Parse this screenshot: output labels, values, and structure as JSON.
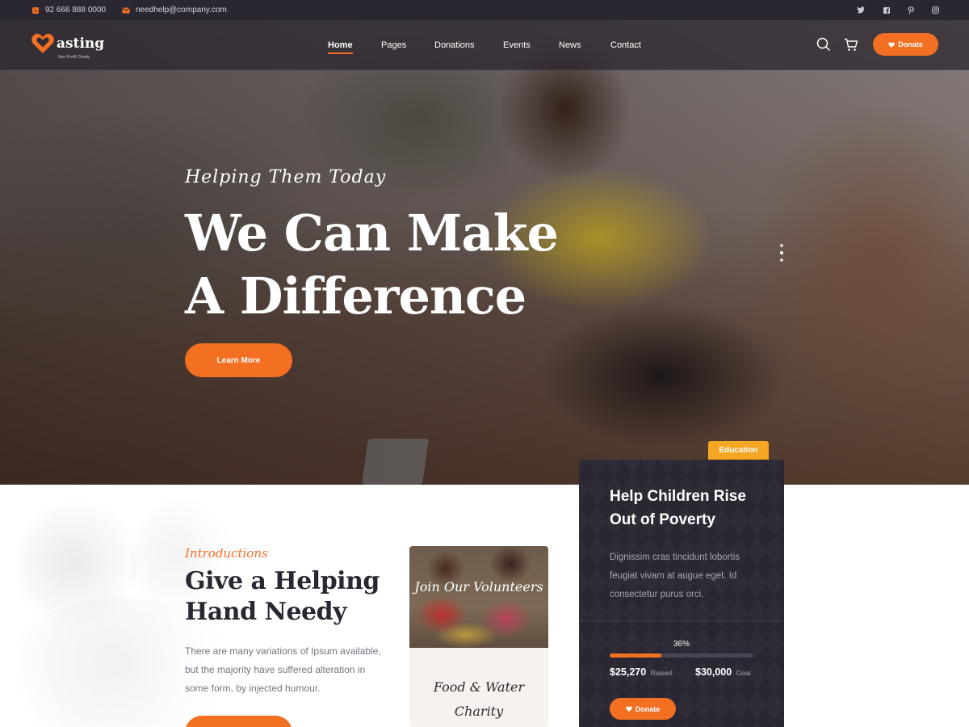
{
  "topbar": {
    "phone": "92 666 888 0000",
    "email": "needhelp@company.com",
    "social": [
      "twitter-icon",
      "facebook-icon",
      "pinterest-icon",
      "instagram-icon"
    ]
  },
  "brand": {
    "name": "asting",
    "tagline": "Non Profit Charity",
    "accent": "#f36f21",
    "dark": "#2a2732",
    "tag_color": "#f5a623"
  },
  "nav": {
    "items": [
      {
        "label": "Home",
        "active": true
      },
      {
        "label": "Pages",
        "active": false
      },
      {
        "label": "Donations",
        "active": false
      },
      {
        "label": "Events",
        "active": false
      },
      {
        "label": "News",
        "active": false
      },
      {
        "label": "Contact",
        "active": false
      }
    ],
    "donate_label": "Donate"
  },
  "hero": {
    "script": "Helping Them Today",
    "title": "We Can Make A Difference",
    "button_label": "Learn More"
  },
  "intro": {
    "eyebrow": "Introductions",
    "title": "Give a Helping Hand Needy",
    "text": "There are many variations of Ipsum available, but the majority have suffered alteration in some form, by injected humour."
  },
  "volunteer_card": {
    "image_text": "Join Our Volunteers",
    "caption": "Food & Water Charity"
  },
  "donation_card": {
    "tag": "Education",
    "title": "Help Children Rise Out of Poverty",
    "text": "Dignissim cras tincidunt lobortis feugiat vivam at augue eget. Id consectetur purus orci.",
    "percent_label": "36%",
    "progress": 0.36,
    "raised_amount": "$25,270",
    "raised_label": "Raised",
    "goal_amount": "$30,000",
    "goal_label": "Goal",
    "button_label": "Donate"
  }
}
